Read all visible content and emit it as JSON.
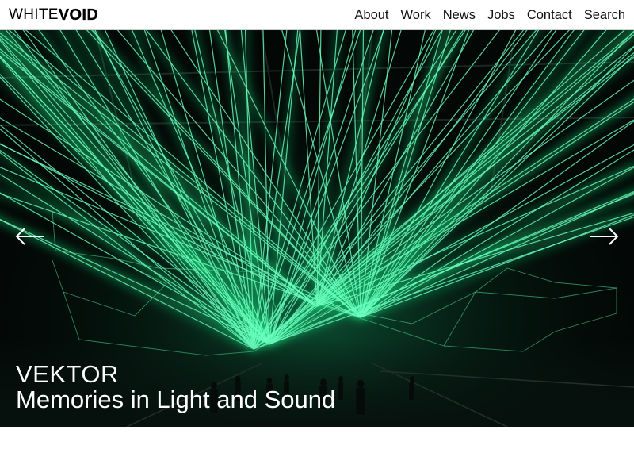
{
  "logo": {
    "part1": "WHITE",
    "part2": "VOID"
  },
  "nav": {
    "items": [
      {
        "label": "About"
      },
      {
        "label": "Work"
      },
      {
        "label": "News"
      },
      {
        "label": "Jobs"
      },
      {
        "label": "Contact"
      },
      {
        "label": "Search"
      }
    ]
  },
  "hero": {
    "title": "VEKTOR",
    "subtitle": "Memories in Light and Sound",
    "prev_icon": "arrow-left-icon",
    "next_icon": "arrow-right-icon",
    "image": "green-laser-installation-photo"
  },
  "colors": {
    "laser": "#2aff9a",
    "background": "#030806",
    "text": "#ffffff"
  }
}
